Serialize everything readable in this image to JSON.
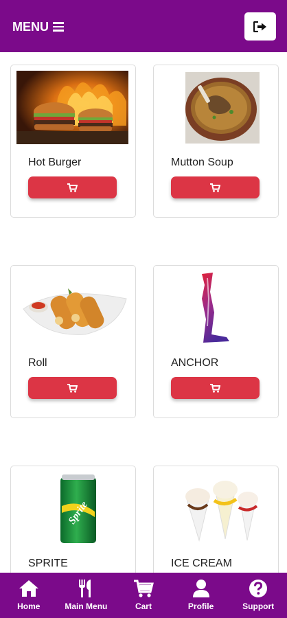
{
  "header": {
    "menu_label": "MENU"
  },
  "products": [
    {
      "name": "Hot Burger",
      "image": "burger"
    },
    {
      "name": "Mutton Soup",
      "image": "soup"
    },
    {
      "name": "Roll",
      "image": "roll"
    },
    {
      "name": "ANCHOR",
      "image": "anchor"
    },
    {
      "name": "SPRITE",
      "image": "sprite-can"
    },
    {
      "name": "ICE CREAM",
      "image": "ice-cream"
    }
  ],
  "nav": [
    {
      "label": "Home",
      "icon": "home-icon"
    },
    {
      "label": "Main Menu",
      "icon": "fork-knife-icon"
    },
    {
      "label": "Cart",
      "icon": "cart-icon"
    },
    {
      "label": "Profile",
      "icon": "profile-icon"
    },
    {
      "label": "Support",
      "icon": "help-icon"
    }
  ],
  "colors": {
    "brand": "#7b0a8a",
    "cart_button": "#dc3545"
  }
}
